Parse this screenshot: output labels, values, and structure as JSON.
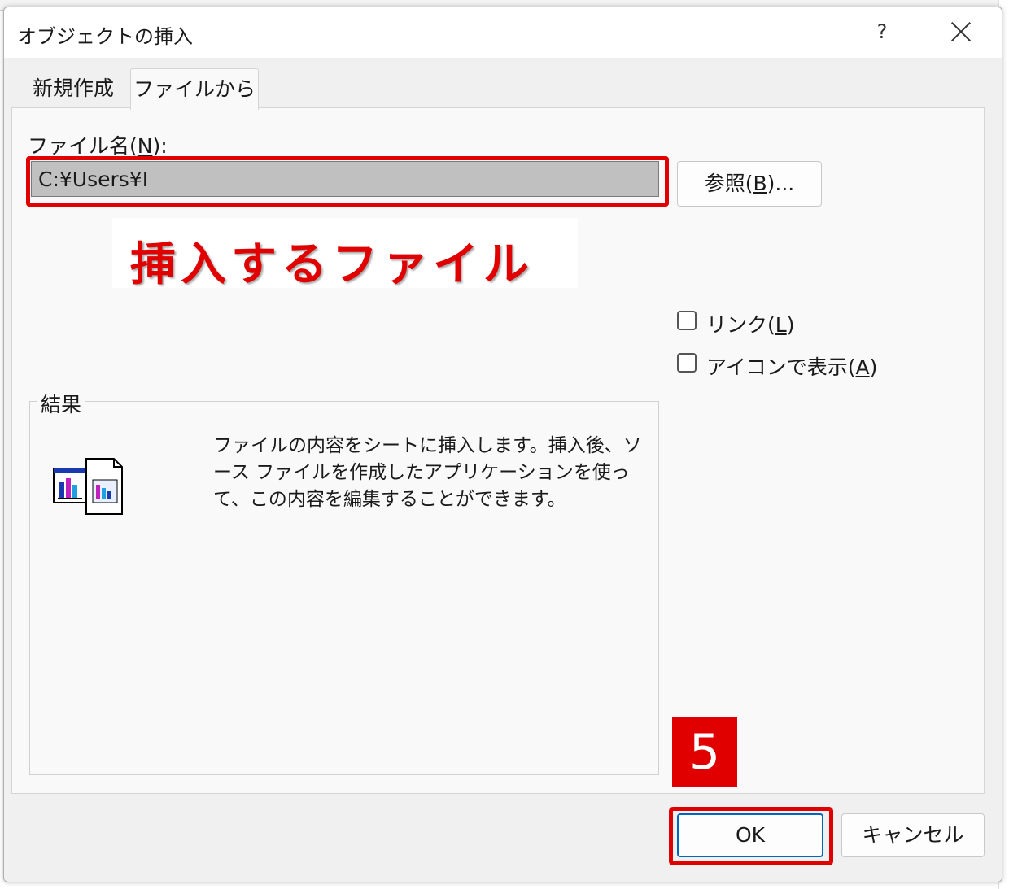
{
  "dialog": {
    "title": "オブジェクトの挿入",
    "help_label": "?",
    "tabs": [
      {
        "label": "新規作成",
        "active": false
      },
      {
        "label": "ファイルから",
        "active": true
      }
    ],
    "filename": {
      "label_pre": "ファイル名(",
      "label_key": "N",
      "label_post": "):",
      "value": "C:¥Users¥I"
    },
    "browse": {
      "pre": "参照(",
      "key": "B",
      "post": ")..."
    },
    "options": {
      "link": {
        "pre": "リンク(",
        "key": "L",
        "post": ")",
        "checked": false
      },
      "display_as_icon": {
        "pre": "アイコンで表示(",
        "key": "A",
        "post": ")",
        "checked": false
      }
    },
    "result": {
      "label": "結果",
      "description": "ファイルの内容をシートに挿入します。挿入後、ソース ファイルを作成したアプリケーションを使って、この内容を編集することができます。"
    },
    "ok_label": "OK",
    "cancel_label": "キャンセル"
  },
  "annotations": {
    "callout_text": "挿入するファイル",
    "step_number": "5",
    "highlight_color": "#e00000"
  },
  "colors": {
    "dialog_bg": "#f0f0f0",
    "focus_border": "#0067c0"
  }
}
